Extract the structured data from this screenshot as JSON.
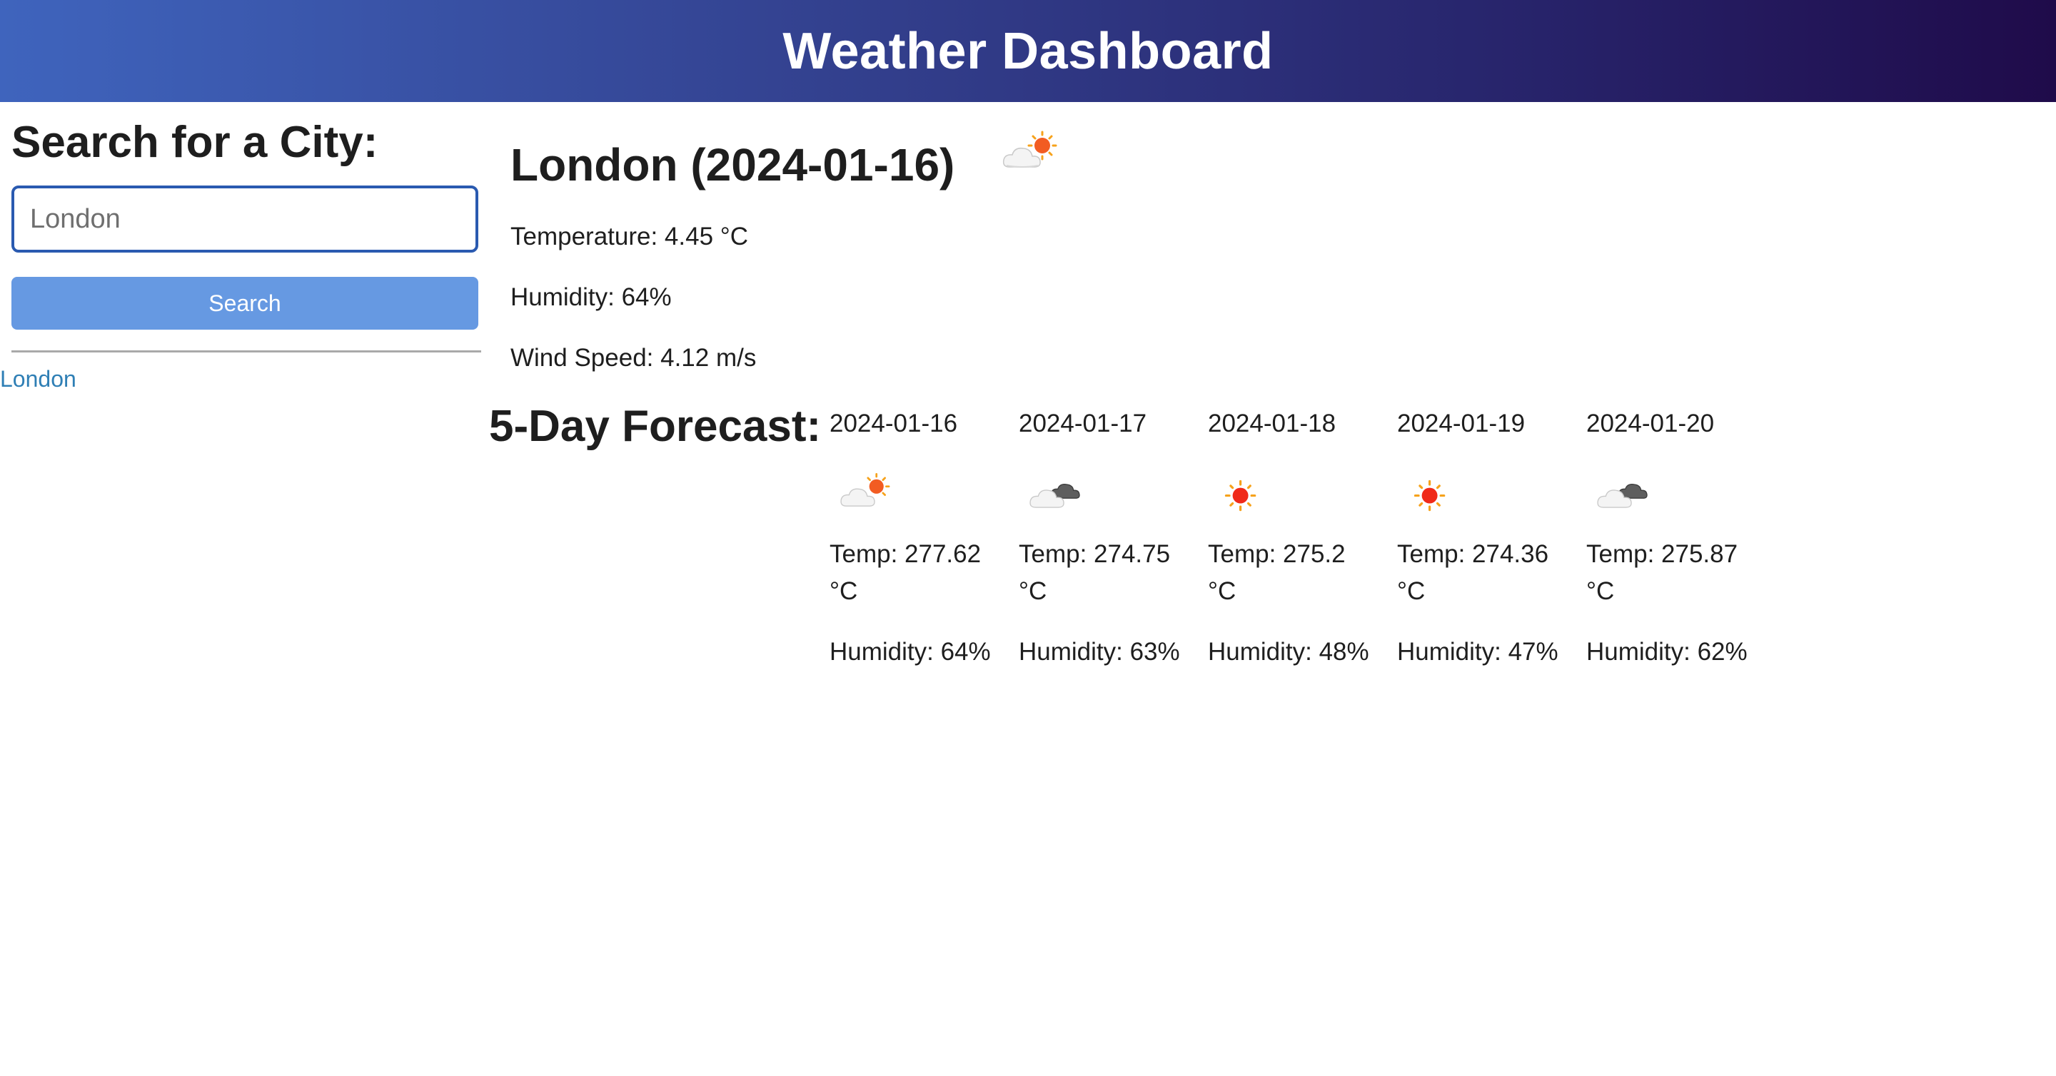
{
  "header": {
    "title": "Weather Dashboard"
  },
  "sidebar": {
    "heading": "Search for a City:",
    "search_placeholder": "London",
    "search_value": "",
    "search_button": "Search",
    "history": [
      {
        "label": "London"
      }
    ]
  },
  "current": {
    "title": "London (2024-01-16)",
    "icon": "partly-cloudy-sun-icon",
    "temperature": "Temperature: 4.45 °C",
    "humidity": "Humidity: 64%",
    "wind": "Wind Speed: 4.12 m/s"
  },
  "forecast": {
    "heading": "5-Day Forecast:",
    "days": [
      {
        "date": "2024-01-16",
        "icon": "partly-cloudy-sun-icon",
        "temp": "Temp: 277.62 °C",
        "humidity": "Humidity: 64%"
      },
      {
        "date": "2024-01-17",
        "icon": "cloudy-icon",
        "temp": "Temp: 274.75 °C",
        "humidity": "Humidity: 63%"
      },
      {
        "date": "2024-01-18",
        "icon": "sun-icon",
        "temp": "Temp: 275.2 °C",
        "humidity": "Humidity: 48%"
      },
      {
        "date": "2024-01-19",
        "icon": "sun-icon",
        "temp": "Temp: 274.36 °C",
        "humidity": "Humidity: 47%"
      },
      {
        "date": "2024-01-20",
        "icon": "cloudy-icon",
        "temp": "Temp: 275.87 °C",
        "humidity": "Humidity: 62%"
      }
    ]
  },
  "colors": {
    "header_start": "#3f64bd",
    "header_end": "#1f0b4a",
    "button": "#6699e2",
    "link": "#2f7fb5",
    "input_border": "#2a5ab0"
  }
}
